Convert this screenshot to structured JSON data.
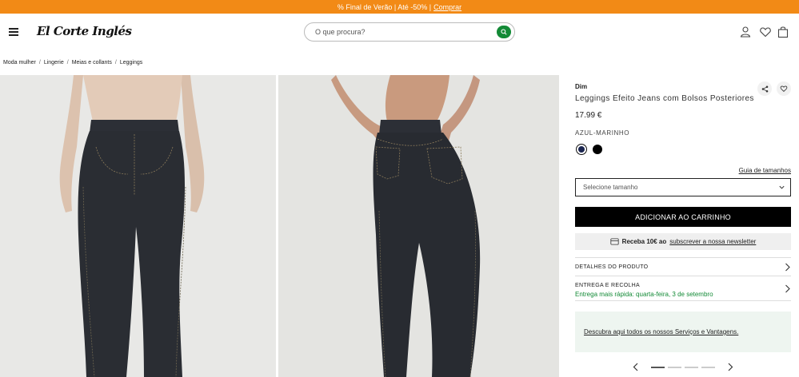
{
  "promo": {
    "text": "% Final de Verão | Até -50% |",
    "link": "Comprar"
  },
  "header": {
    "logo": "El Corte Inglés",
    "search_placeholder": "O que procura?"
  },
  "breadcrumb": [
    "Moda mulher",
    "Lingerie",
    "Meias e collants",
    "Leggings"
  ],
  "product": {
    "brand": "Dim",
    "title": "Leggings Efeito Jeans com Bolsos Posteriores",
    "price": "17.99 €",
    "color_name": "AZUL-MARINHO",
    "swatches": [
      {
        "color": "#1b2550",
        "selected": true
      },
      {
        "color": "#000000",
        "selected": false
      }
    ],
    "size_guide": "Guia de tamanhos",
    "size_placeholder": "Selecione tamanho",
    "add_to_cart": "ADICIONAR AO CARRINHO",
    "newsletter": {
      "prefix": "Receba 10€ ao",
      "link": "subscrever a nossa newsletter"
    },
    "details_label": "DETALHES DO PRODUTO",
    "delivery_label": "ENTREGA E RECOLHA",
    "delivery_sub": "Entrega mais rápida: quarta-feira, 3 de setembro",
    "services_link": "Descubra aqui todos os nossos Serviços e Vantagens.",
    "pager": {
      "count": 4,
      "active_index": 0
    }
  },
  "colors": {
    "promo": "#f28a16",
    "accent_green": "#138a36",
    "denim": "#2a2d33"
  }
}
